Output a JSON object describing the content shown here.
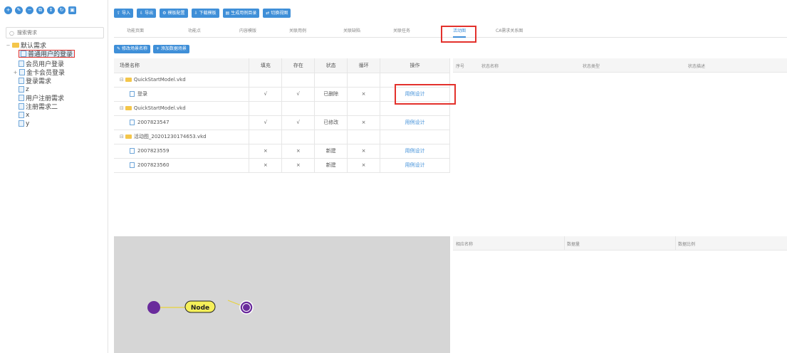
{
  "toolbar_icons": [
    "circle-icon",
    "circle-icon",
    "circle-icon",
    "circle-icon",
    "circle-icon",
    "circle-icon",
    "square-icon"
  ],
  "search": {
    "placeholder": "搜索需求"
  },
  "tree": {
    "root": "默认需求",
    "items": [
      "普通用户的登录",
      "会员用户登录",
      "金卡会员登录",
      "登录需求",
      "z",
      "用户注册需求",
      "注册需求二",
      "x",
      "y"
    ],
    "selected": "普通用户的登录"
  },
  "toolbar": {
    "buttons": [
      "导入",
      "导出",
      "模板配置",
      "下载模板",
      "生成用例目录",
      "切换视图"
    ]
  },
  "tabs": {
    "items": [
      "功能页面",
      "功能点",
      "内容模版",
      "关联用例",
      "关联缺陷",
      "关联任务",
      "活动图",
      "CA需求关系图"
    ],
    "active": "活动图"
  },
  "sub_actions": [
    "修改场景名称",
    "添加数据场景"
  ],
  "scenario_table": {
    "headers": [
      "场景名称",
      "填充",
      "存在",
      "状态",
      "循环",
      "操作"
    ],
    "rows": [
      {
        "kind": "folder",
        "name": "QuickStartModel.vkd"
      },
      {
        "kind": "file",
        "name": "登录",
        "fill": "√",
        "exist": "√",
        "status": "已删除",
        "loop": "×",
        "op": "用例设计"
      },
      {
        "kind": "folder",
        "name": "QuickStartModel.vkd"
      },
      {
        "kind": "file",
        "name": "2007823547",
        "fill": "√",
        "exist": "√",
        "status": "已修改",
        "loop": "×",
        "op": "用例设计"
      },
      {
        "kind": "folder",
        "name": "活动图_20201230174653.vkd"
      },
      {
        "kind": "file",
        "name": "2007823559",
        "fill": "×",
        "exist": "×",
        "status": "新建",
        "loop": "×",
        "op": "用例设计"
      },
      {
        "kind": "file",
        "name": "2007823560",
        "fill": "×",
        "exist": "×",
        "status": "新建",
        "loop": "×",
        "op": "用例设计"
      }
    ]
  },
  "state_table": {
    "headers": [
      "序号",
      "状态名称",
      "状态类型",
      "状态描述"
    ]
  },
  "graph": {
    "node_label": "Node",
    "node_color": "#f5ef5a",
    "dot_color": "#6a2b9c"
  },
  "variable_table": {
    "headers": [
      "相应名称",
      "数据量",
      "数据比例"
    ]
  },
  "colors": {
    "accent": "#3f8fd8",
    "highlight": "#e3312c"
  }
}
